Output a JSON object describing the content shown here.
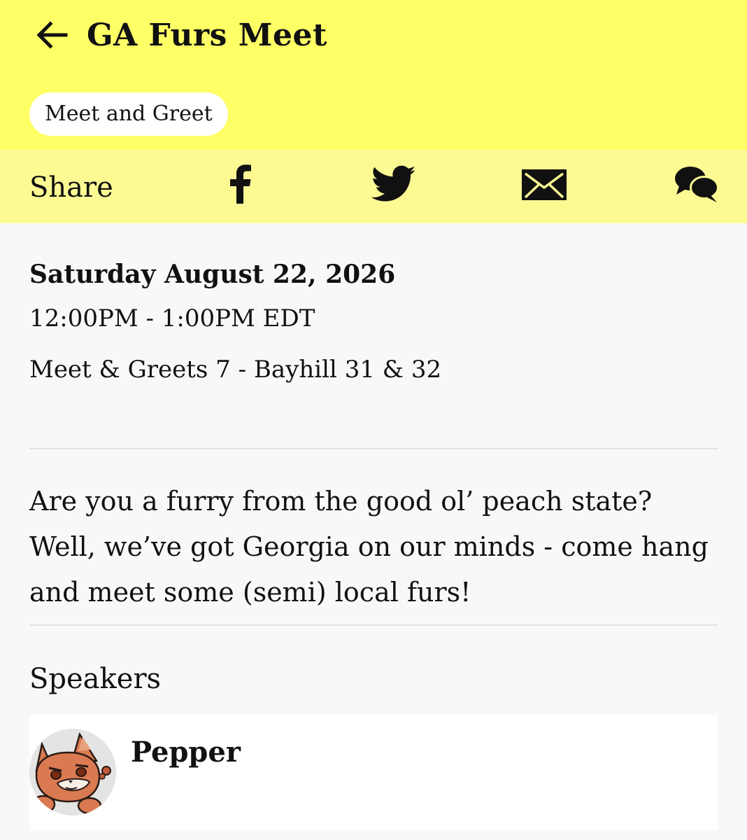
{
  "header": {
    "title": "GA Furs Meet",
    "back_icon": "arrow-left-icon",
    "tag": "Meet and Greet",
    "background_color": "#ffff66"
  },
  "share": {
    "label": "Share",
    "icons": [
      "facebook-icon",
      "twitter-icon",
      "email-icon",
      "chat-icon"
    ],
    "background_color": "#fdfa94"
  },
  "event": {
    "date": "Saturday August 22, 2026",
    "time": "12:00PM - 1:00PM EDT",
    "location": "Meet & Greets 7 - Bayhill 31 & 32",
    "description": "Are you a furry from the good ol’ peach state? Well, we’ve got Georgia on our minds - come hang and meet some (semi) local furs!"
  },
  "speakers": {
    "heading": "Speakers",
    "items": [
      {
        "name": "Pepper",
        "avatar_icon": "fox-avatar-icon"
      }
    ]
  }
}
